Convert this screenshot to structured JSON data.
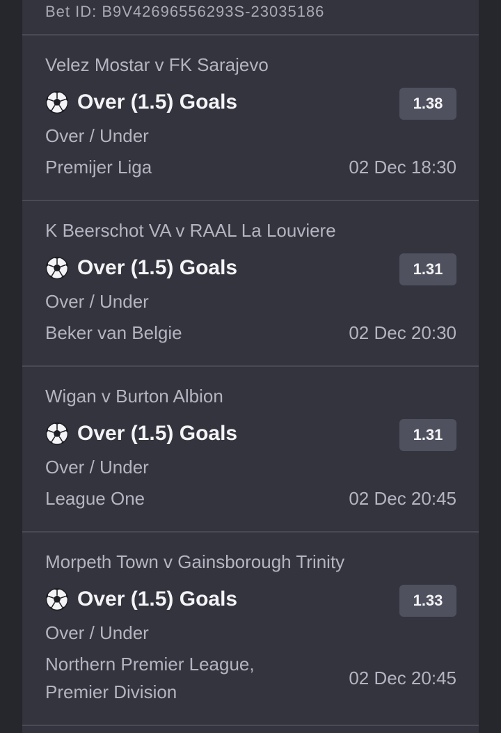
{
  "bet_id": "Bet ID: B9V42696556293S-23035186",
  "colors": {
    "background": "#26272d",
    "panel": "#33343e",
    "divider": "#484a55",
    "odds_badge": "#4f515e",
    "primary_text": "#f4f4f7",
    "secondary_text": "#b4b5c0"
  },
  "selections": [
    {
      "match": "Velez Mostar v FK Sarajevo",
      "sport_icon": "soccer-ball-icon",
      "outcome": "Over (1.5) Goals",
      "odds": "1.38",
      "market": "Over / Under",
      "league": "Premijer Liga",
      "kickoff": "02 Dec 18:30"
    },
    {
      "match": "K Beerschot VA v RAAL La Louviere",
      "sport_icon": "soccer-ball-icon",
      "outcome": "Over (1.5) Goals",
      "odds": "1.31",
      "market": "Over / Under",
      "league": "Beker van Belgie",
      "kickoff": "02 Dec 20:30"
    },
    {
      "match": "Wigan v Burton Albion",
      "sport_icon": "soccer-ball-icon",
      "outcome": "Over (1.5) Goals",
      "odds": "1.31",
      "market": "Over / Under",
      "league": "League One",
      "kickoff": "02 Dec 20:45"
    },
    {
      "match": "Morpeth Town v Gainsborough Trinity",
      "sport_icon": "soccer-ball-icon",
      "outcome": "Over (1.5) Goals",
      "odds": "1.33",
      "market": "Over / Under",
      "league": "Northern Premier League, Premier Division",
      "kickoff": "02 Dec 20:45"
    }
  ]
}
